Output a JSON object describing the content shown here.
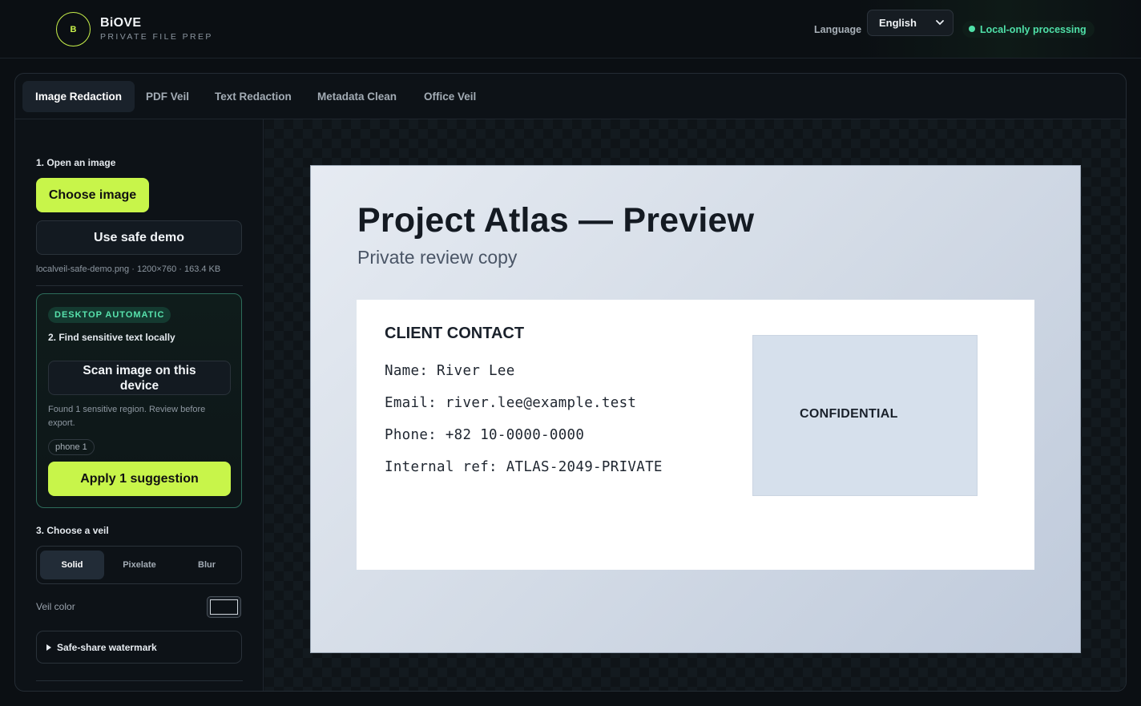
{
  "header": {
    "logo_letter": "B",
    "brand_name": "BiOVE",
    "brand_sub": "PRIVATE FILE PREP",
    "language_label": "Language",
    "language_value": "English",
    "status_text": "Local-only processing"
  },
  "tabs": [
    {
      "label": "Image Redaction",
      "active": true
    },
    {
      "label": "PDF Veil"
    },
    {
      "label": "Text Redaction"
    },
    {
      "label": "Metadata Clean"
    },
    {
      "label": "Office Veil"
    }
  ],
  "sidebar": {
    "step1_title": "1. Open an image",
    "choose_label": "Choose image",
    "demo_label": "Use safe demo",
    "file_info": "localveil-safe-demo.png · 1200×760 · 163.4 KB",
    "auto_badge": "DESKTOP AUTOMATIC",
    "step2_title": "2. Find sensitive text locally",
    "scan_label": "Scan image on this device",
    "found_text": "Found 1 sensitive region. Review before export.",
    "chip_label": "phone 1",
    "apply_label": "Apply 1 suggestion",
    "step3_title": "3. Choose a veil",
    "veil_options": [
      "Solid",
      "Pixelate",
      "Blur"
    ],
    "veil_selected": "Solid",
    "veil_color_label": "Veil color",
    "veil_color": "#0d1217",
    "watermark_label": "Safe-share watermark"
  },
  "preview": {
    "title": "Project Atlas — Preview",
    "subtitle": "Private review copy",
    "card_heading": "CLIENT CONTACT",
    "lines": [
      "Name: River Lee",
      "Email: river.lee@example.test",
      "Phone: +82 10-0000-0000",
      "Internal ref: ATLAS-2049-PRIVATE"
    ],
    "stamp": "CONFIDENTIAL"
  },
  "colors": {
    "accent": "#c8f54a",
    "status_green": "#4fe0a8",
    "background": "#0b0f13"
  }
}
